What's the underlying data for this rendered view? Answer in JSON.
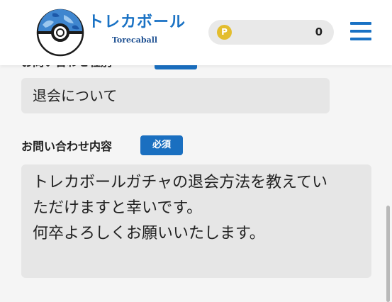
{
  "header": {
    "brand_name": "トレカボール",
    "brand_subtitle": "Torecaball",
    "coin_symbol": "P",
    "coin_count": "0",
    "accent_color": "#1a72c4",
    "logo_icon": "pokeball-logo-icon",
    "menu_icon": "hamburger-menu-icon"
  },
  "form": {
    "inquiry_type": {
      "label": "お問い合わせ種別",
      "value": "退会について"
    },
    "inquiry_content": {
      "label": "お問い合わせ内容",
      "required_badge": "必須",
      "value": "トレカボールガチャの退会方法を教えてい\nただけますと幸いです。\n何卒よろしくお願いいたします。"
    }
  },
  "colors": {
    "badge": "#1a6fc0",
    "field_background": "#e6e6e6",
    "page_background": "#f5f5f5"
  }
}
